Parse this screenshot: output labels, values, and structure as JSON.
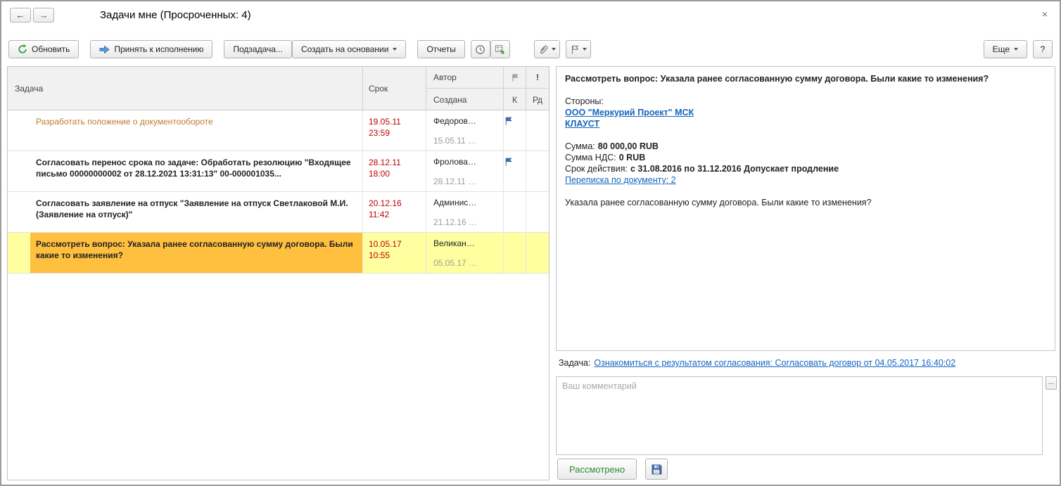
{
  "window": {
    "title": "Задачи мне (Просроченных: 4)",
    "close": "×"
  },
  "nav": {
    "back": "←",
    "forward": "→"
  },
  "toolbar": {
    "refresh": "Обновить",
    "accept": "Принять к исполнению",
    "subtask": "Подзадача...",
    "create_based_on": "Создать на основании",
    "reports": "Отчеты",
    "more": "Еще",
    "help": "?"
  },
  "table": {
    "headers": {
      "task": "Задача",
      "deadline": "Срок",
      "author": "Автор",
      "created": "Создана",
      "importance": "!",
      "k": "К",
      "rd": "Рд"
    },
    "rows": [
      {
        "task": "Разработать положение о документообороте",
        "deadline_date": "19.05.11",
        "deadline_time": "23:59",
        "author": "Федоров…",
        "created": "15.05.11 …"
      },
      {
        "task": "Согласовать перенос срока по задаче: Обработать резолюцию \"Входящее письмо 00000000002 от 28.12.2021 13:31:13\" 00-000001035...",
        "deadline_date": "28.12.11",
        "deadline_time": "18:00",
        "author": "Фролова…",
        "created": "28.12.11 …"
      },
      {
        "task": "Согласовать заявление на отпуск \"Заявление на отпуск Светлаковой М.И. (Заявление на отпуск)\"",
        "deadline_date": "20.12.16",
        "deadline_time": "11:42",
        "author": "Админис…",
        "created": "21.12.16 …"
      },
      {
        "task": "Рассмотреть вопрос: Указала ранее согласованную сумму договора. Были какие то изменения?",
        "deadline_date": "10.05.17",
        "deadline_time": "10:55",
        "author": "Великан…",
        "created": "05.05.17 …"
      }
    ]
  },
  "details": {
    "title": "Рассмотреть вопрос: Указала ранее согласованную сумму договора. Были какие то изменения?",
    "parties_label": "Стороны:",
    "party1": "ООО \"Меркурий Проект\" МСК",
    "party2": "КЛАУСТ",
    "sum_label": "Сумма:",
    "sum_value": "80 000,00 RUB",
    "vat_label": "Сумма НДС:",
    "vat_value": "0 RUB",
    "validity_label": "Срок действия:",
    "validity_value": "с 31.08.2016 по 31.12.2016 Допускает продление",
    "correspondence_link": "Переписка по документу: 2",
    "question": "Указала ранее согласованную сумму договора. Были какие то изменения?"
  },
  "task_line": {
    "label": "Задача:",
    "link": "Ознакомиться с результатом согласования: Согласовать договор от 04.05.2017 16:40:02"
  },
  "comment": {
    "placeholder": "Ваш комментарий",
    "more": "..."
  },
  "actions": {
    "reviewed": "Рассмотрено"
  },
  "colors": {
    "overdue_red": "#c00000",
    "link_blue": "#1565c0",
    "selected_row": "#ffffa0",
    "selected_cell": "#ffbf3f",
    "overdue_task_text": "#c07830",
    "reviewed_green": "#2e8b2e",
    "flag_blue": "#3b6fd4"
  }
}
